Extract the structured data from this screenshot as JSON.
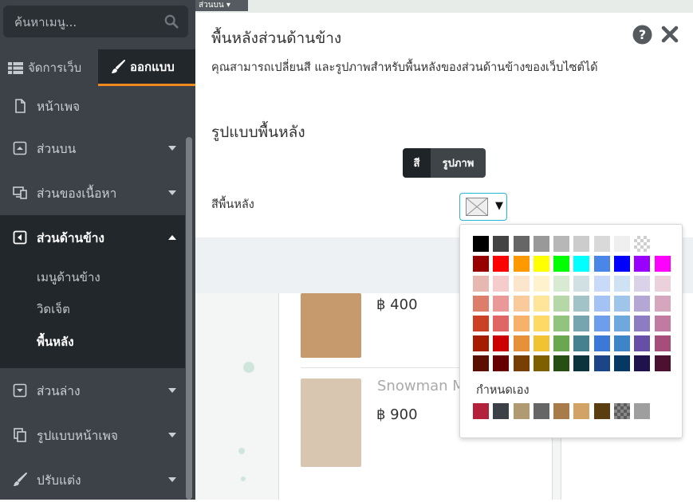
{
  "sidebar": {
    "search_placeholder": "ค้นหาเมนู...",
    "tabs": {
      "manage": "จัดการเว็บ",
      "design": "ออกแบบ"
    },
    "items": [
      {
        "label": "หน้าเพจ"
      },
      {
        "label": "ส่วนบน"
      },
      {
        "label": "ส่วนของเนื้อหา"
      },
      {
        "label": "ส่วนด้านข้าง"
      },
      {
        "label": "ส่วนล่าง"
      },
      {
        "label": "รูปแบบหน้าเพจ"
      },
      {
        "label": "ปรับแต่ง"
      }
    ],
    "submenu": [
      "เมนูด้านข้าง",
      "วิดเจ็ต",
      "พื้นหลัง"
    ]
  },
  "preview": {
    "top_tag": "ส่วนบน ▾",
    "products": [
      {
        "price": "฿ 400"
      },
      {
        "name": "Snowman M",
        "price": "฿ 900"
      }
    ]
  },
  "dialog": {
    "title": "พื้นหลังส่วนด้านข้าง",
    "description": "คุณสามารถเปลี่ยนสี และรูปภาพสำหรับพื้นหลังของส่วนด้านข้างของเว็บไซต์ได้",
    "section_title": "รูปแบบพื้นหลัง",
    "toggle": {
      "color": "สี",
      "image": "รูปภาพ"
    },
    "bg_color_label": "สีพื้นหลัง",
    "swatch_arrow": "▼"
  },
  "palette": {
    "rows": [
      [
        "#000000",
        "#434343",
        "#666666",
        "#999999",
        "#b7b7b7",
        "#cccccc",
        "#d9d9d9",
        "#efefef",
        "transparent"
      ],
      [
        "#980000",
        "#ff0000",
        "#ff9900",
        "#ffff00",
        "#00ff00",
        "#00ffff",
        "#4a86e8",
        "#0000ff",
        "#9900ff",
        "#ff00ff"
      ],
      [
        "#e6b8af",
        "#f4cccc",
        "#fce5cd",
        "#fff2cc",
        "#d9ead3",
        "#d0e0e3",
        "#c9daf8",
        "#cfe2f3",
        "#d9d2e9",
        "#ead1dc"
      ],
      [
        "#dd7e6b",
        "#ea9999",
        "#f9cb9c",
        "#ffe599",
        "#b6d7a8",
        "#a2c4c9",
        "#a4c2f4",
        "#9fc5e8",
        "#b4a7d6",
        "#d5a6bd"
      ],
      [
        "#cc4125",
        "#e06666",
        "#f6b26b",
        "#ffd966",
        "#93c47d",
        "#76a5af",
        "#6d9eeb",
        "#6fa8dc",
        "#8e7cc3",
        "#c27ba0"
      ],
      [
        "#a61c00",
        "#cc0000",
        "#e69138",
        "#f1c232",
        "#6aa84f",
        "#45818e",
        "#3c78d8",
        "#3d85c6",
        "#674ea7",
        "#a64d79"
      ],
      [
        "#5b0f00",
        "#660000",
        "#783f04",
        "#7f6000",
        "#274e13",
        "#0c343d",
        "#1c4587",
        "#073763",
        "#20124d",
        "#4c1130"
      ]
    ],
    "custom_label": "กำหนดเอง",
    "custom_row": [
      "#b3223a",
      "#3c4148",
      "#b09a72",
      "#666666",
      "#a87c4a",
      "#d3a366",
      "#5b3e0f",
      "checker-dark",
      "#9e9e9e"
    ]
  }
}
